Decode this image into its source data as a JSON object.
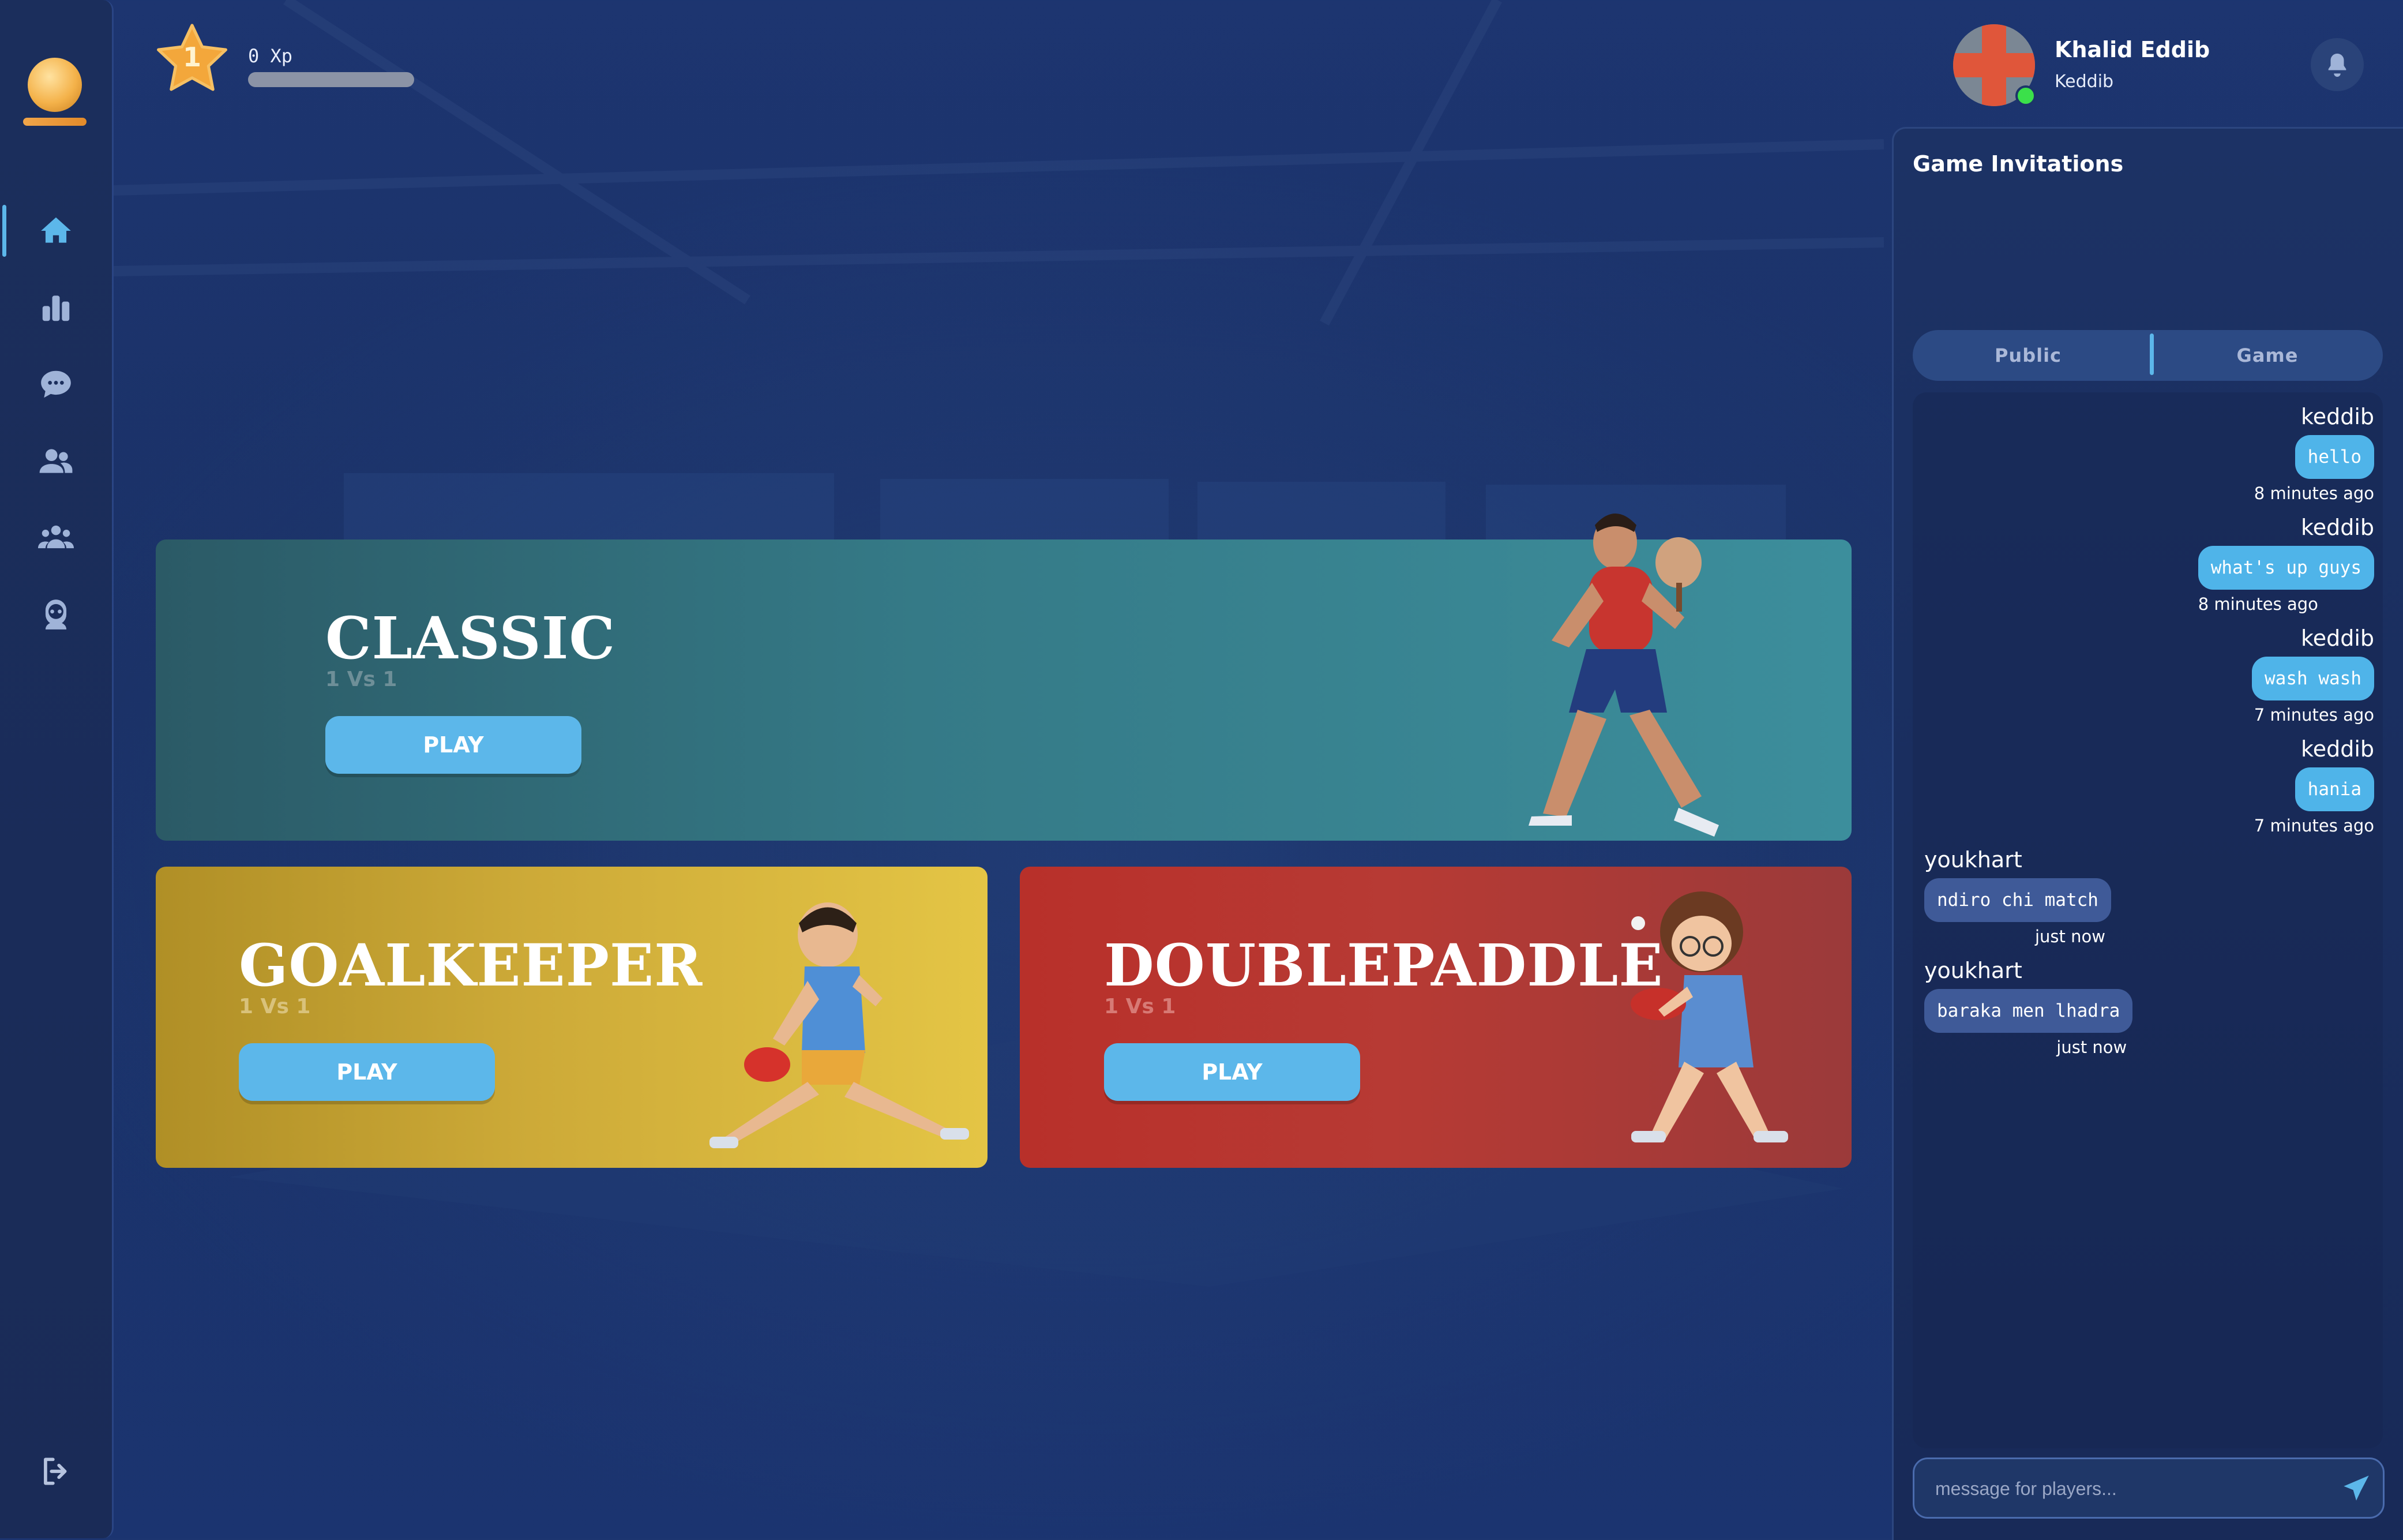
{
  "colors": {
    "background": "#1b3470",
    "accent": "#5cb7ea",
    "classic_card": "#3a8a96",
    "goalkeeper_card": "#e2c33f",
    "doublepaddle_card": "#b8302a"
  },
  "sidebar": {
    "logo_icon": "orange-ball-logo",
    "items": [
      {
        "icon": "home-icon",
        "active": true
      },
      {
        "icon": "stats-icon",
        "active": false
      },
      {
        "icon": "chat-icon",
        "active": false
      },
      {
        "icon": "friends-icon",
        "active": false
      },
      {
        "icon": "group-icon",
        "active": false
      },
      {
        "icon": "bot-icon",
        "active": false
      }
    ],
    "logout_icon": "logout-icon"
  },
  "header": {
    "level": "1",
    "xp_label": "0 Xp",
    "xp_progress": 0
  },
  "user": {
    "name": "Khalid Eddib",
    "handle": "Keddib",
    "online": true
  },
  "modes": [
    {
      "title": "CLASSIC",
      "subtitle": "1 Vs 1",
      "play_label": "PLAY"
    },
    {
      "title": "GOALKEEPER",
      "subtitle": "1 Vs 1",
      "play_label": "PLAY"
    },
    {
      "title": "DOUBLEPADDLE",
      "subtitle": "1 Vs 1",
      "play_label": "PLAY"
    }
  ],
  "invitations": {
    "title": "Game Invitations"
  },
  "chat": {
    "tabs": [
      "Public",
      "Game"
    ],
    "messages": [
      {
        "user": "keddib",
        "text": "hello",
        "time": "8 minutes ago",
        "mine": true
      },
      {
        "user": "keddib",
        "text": "what's up guys",
        "time": "8 minutes ago",
        "mine": true
      },
      {
        "user": "keddib",
        "text": "wash wash",
        "time": "7 minutes ago",
        "mine": true
      },
      {
        "user": "keddib",
        "text": "hania",
        "time": "7 minutes ago",
        "mine": true
      },
      {
        "user": "youkhart",
        "text": "ndiro chi match",
        "time": "just now",
        "mine": false
      },
      {
        "user": "youkhart",
        "text": "baraka men lhadra",
        "time": "just now",
        "mine": false
      }
    ],
    "input_placeholder": "message for players..."
  }
}
